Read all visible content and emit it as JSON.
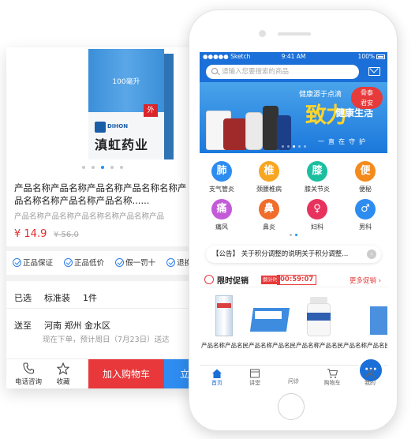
{
  "detail": {
    "box_volume": "100毫升",
    "box_tag": "外",
    "brand_en": "DIHON",
    "brand_cn": "滇虹药业",
    "product_name": "产品名称产品名称产品名称产品名称名称产品名称名称产品名称产品名称......",
    "product_sub": "产品名称产品名称产品名称名称产品名称产品",
    "price": "¥ 14.9",
    "old_price": "¥ 56.0",
    "guarantees": [
      "正品保证",
      "正品低价",
      "假一罚十",
      "退换"
    ],
    "selected_label": "已选",
    "selected_spec": "标准装",
    "selected_qty": "1件",
    "ship_label": "送至",
    "ship_addr": "河南 郑州 金水区",
    "ship_note": "现在下单，预计周日（7月23日）送达",
    "bottom": {
      "phone_label": "电话咨询",
      "fav_label": "收藏",
      "add_cart": "加入购物车",
      "buy_now": "立即购买"
    }
  },
  "phone": {
    "status": {
      "carrier": "●●●●● Sketch",
      "time": "9:41 AM",
      "battery": "100%"
    },
    "search_placeholder": "请输入您要搜索的商品",
    "banner": {
      "line1": "健康源于点滴",
      "big": "致力",
      "small1": "健康生活",
      "small2": "健康生活",
      "tag1": "骨泰",
      "tag2": "君安",
      "foot": "一直在守护"
    },
    "categories": [
      {
        "label": "支气管炎",
        "icon": "lungs-icon",
        "color": "#2d8cf0",
        "glyph": "肺"
      },
      {
        "label": "颈腰椎病",
        "icon": "spine-icon",
        "color": "#f7a623",
        "glyph": "椎"
      },
      {
        "label": "膝关节炎",
        "icon": "knee-icon",
        "color": "#1bbf9f",
        "glyph": "膝"
      },
      {
        "label": "便秘",
        "icon": "toilet-icon",
        "color": "#f48a1c",
        "glyph": "便"
      },
      {
        "label": "痛风",
        "icon": "foot-icon",
        "color": "#c35bd8",
        "glyph": "痛"
      },
      {
        "label": "鼻炎",
        "icon": "nose-icon",
        "color": "#f06d2c",
        "glyph": "鼻"
      },
      {
        "label": "妇科",
        "icon": "female-icon",
        "color": "#e8325e",
        "glyph": "♀"
      },
      {
        "label": "男科",
        "icon": "male-icon",
        "color": "#2d8cf0",
        "glyph": "♂"
      }
    ],
    "notice": "【公告】 关于积分调整的说明关于积分调整...",
    "promo": {
      "title": "限时促销",
      "countdown_label": "倒计时",
      "time": "00:59:07",
      "more": "更多促销"
    },
    "goods_name": "产品名称产品名民女",
    "tabs": [
      {
        "label": "首页",
        "icon": "home-icon"
      },
      {
        "label": "讲堂",
        "icon": "lecture-icon"
      },
      {
        "label": "问诊",
        "icon": "consult-icon"
      },
      {
        "label": "购物车",
        "icon": "cart-icon"
      },
      {
        "label": "我的",
        "icon": "profile-icon"
      }
    ]
  }
}
